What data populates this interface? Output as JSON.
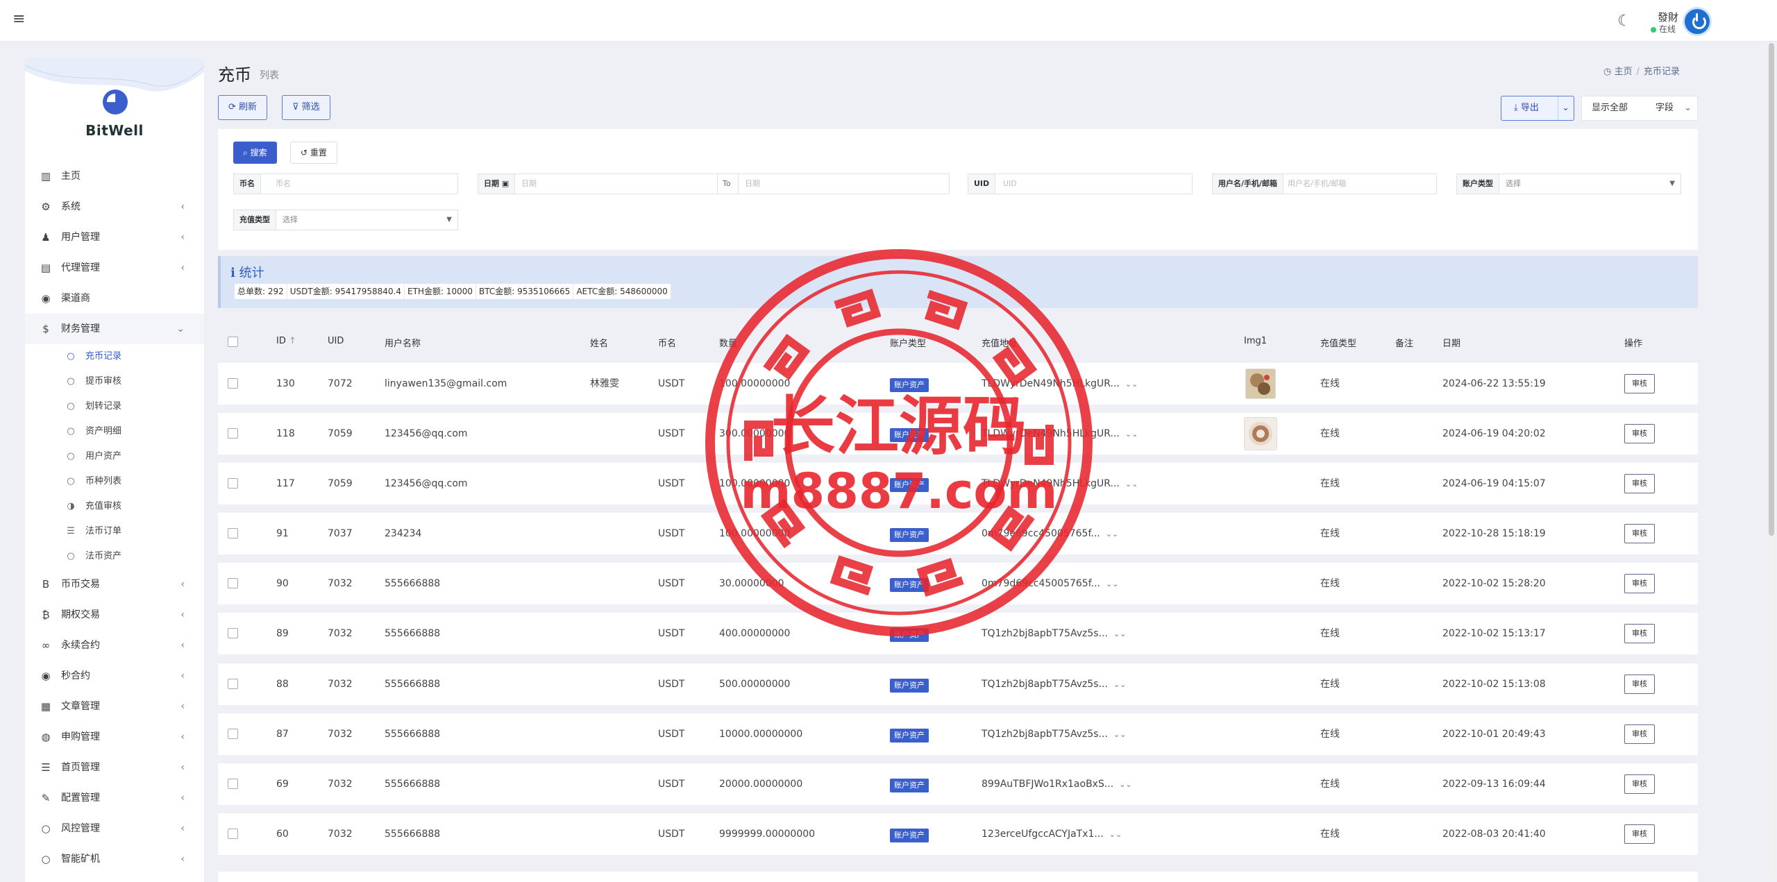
{
  "app": {
    "name": "BitWell"
  },
  "user": {
    "name": "發財",
    "status": "在线"
  },
  "page": {
    "title": "充币",
    "subtitle": "列表"
  },
  "breadcrumb": {
    "home": "主页",
    "current": "充币记录"
  },
  "toolbar": {
    "refresh": "刷新",
    "filter": "筛选",
    "export": "导出",
    "show_all": "显示全部",
    "fields": "字段"
  },
  "search": {
    "search_btn": "搜索",
    "reset_btn": "重置",
    "coin_label": "币名",
    "coin_ph": "币名",
    "date_label": "日期",
    "date_from_ph": "日期",
    "date_to": "To",
    "date_to_ph": "日期",
    "uid_label": "UID",
    "uid_ph": "UID",
    "user_label": "用户名/手机/邮箱",
    "user_ph": "用户名/手机/邮箱",
    "acct_label": "账户类型",
    "acct_ph": "选择",
    "recharge_label": "充值类型",
    "recharge_ph": "选择"
  },
  "stats": {
    "title": "统计",
    "items": [
      "总单数:  292",
      "USDT金额:  95417958840.4",
      "ETH金额:  10000",
      "BTC金额:  9535106665",
      "AETC金额:  548600000"
    ]
  },
  "sidebar": {
    "items": [
      {
        "label": "主页",
        "icon": "bar-chart-icon",
        "glyph": "▥"
      },
      {
        "label": "系统",
        "icon": "gear-icon",
        "glyph": "⚙",
        "chev": "‹"
      },
      {
        "label": "用户管理",
        "icon": "user-icon",
        "glyph": "♟",
        "chev": "‹"
      },
      {
        "label": "代理管理",
        "icon": "id-card-icon",
        "glyph": "▤",
        "chev": "‹"
      },
      {
        "label": "渠道商",
        "icon": "user-circle-icon",
        "glyph": "◉"
      },
      {
        "label": "财务管理",
        "icon": "dollar-icon",
        "glyph": "$",
        "chev": "⌄",
        "open": true
      }
    ],
    "finance_sub": [
      {
        "label": "充币记录",
        "icon": "circle-icon",
        "glyph": "○",
        "active": true
      },
      {
        "label": "提币审核",
        "icon": "circle-icon",
        "glyph": "○"
      },
      {
        "label": "划转记录",
        "icon": "circle-icon",
        "glyph": "○"
      },
      {
        "label": "资产明细",
        "icon": "circle-icon",
        "glyph": "○"
      },
      {
        "label": "用户资产",
        "icon": "circle-icon",
        "glyph": "○"
      },
      {
        "label": "币种列表",
        "icon": "circle-icon",
        "glyph": "○"
      },
      {
        "label": "充值审核",
        "icon": "half-circle-icon",
        "glyph": "◑"
      },
      {
        "label": "法币订单",
        "icon": "list-icon",
        "glyph": "☰"
      },
      {
        "label": "法币资产",
        "icon": "circle-icon",
        "glyph": "○"
      }
    ],
    "items2": [
      {
        "label": "币币交易",
        "icon": "bitcoin-icon",
        "glyph": "B",
        "chev": "‹"
      },
      {
        "label": "期权交易",
        "icon": "bitcoin-icon",
        "glyph": "₿",
        "chev": "‹"
      },
      {
        "label": "永续合约",
        "icon": "link-icon",
        "glyph": "∞",
        "chev": "‹"
      },
      {
        "label": "秒合约",
        "icon": "dot-circle-icon",
        "glyph": "◉",
        "chev": "‹"
      },
      {
        "label": "文章管理",
        "icon": "newspaper-icon",
        "glyph": "▦",
        "chev": "‹"
      },
      {
        "label": "申购管理",
        "icon": "globe-icon",
        "glyph": "◍",
        "chev": "‹"
      },
      {
        "label": "首页管理",
        "icon": "list-icon",
        "glyph": "☰",
        "chev": "‹"
      },
      {
        "label": "配置管理",
        "icon": "wrench-icon",
        "glyph": "✎",
        "chev": "‹"
      },
      {
        "label": "风控管理",
        "icon": "circle-icon",
        "glyph": "○",
        "chev": "‹"
      },
      {
        "label": "智能矿机",
        "icon": "circle-icon",
        "glyph": "○",
        "chev": "‹"
      }
    ]
  },
  "table": {
    "headers": [
      "ID",
      "UID",
      "用户名称",
      "姓名",
      "币名",
      "数量",
      "账户类型",
      "充值地址",
      "Img1",
      "充值类型",
      "备注",
      "日期",
      "操作"
    ],
    "sort_glyph": "↑",
    "rows": [
      {
        "id": "130",
        "uid": "7072",
        "user": "linyawen135@gmail.com",
        "name": "林雅雯",
        "coin": "USDT",
        "amount": "100.00000000",
        "acct": "账户资产",
        "addr": "TLDWyrDeN49Nh5HLkgUR...",
        "img": "food",
        "rtype": "在线",
        "note": "",
        "date": "2024-06-22 13:55:19",
        "op": "审核"
      },
      {
        "id": "118",
        "uid": "7059",
        "user": "123456@qq.com",
        "name": "",
        "coin": "USDT",
        "amount": "300.00000000",
        "acct": "账户资产",
        "addr": "TLDWyrDeN49Nh5HLkgUR...",
        "img": "coffee",
        "rtype": "在线",
        "note": "",
        "date": "2024-06-19 04:20:02",
        "op": "审核"
      },
      {
        "id": "117",
        "uid": "7059",
        "user": "123456@qq.com",
        "name": "",
        "coin": "USDT",
        "amount": "100.00000000",
        "acct": "账户资产",
        "addr": "TLDWyrDeN49Nh5HLkgUR...",
        "img": "",
        "rtype": "在线",
        "note": "",
        "date": "2024-06-19 04:15:07",
        "op": "审核"
      },
      {
        "id": "91",
        "uid": "7037",
        "user": "234234",
        "name": "",
        "coin": "USDT",
        "amount": "100.00000000",
        "acct": "账户资产",
        "addr": "0m79e69cc45005765f...",
        "img": "",
        "rtype": "在线",
        "note": "",
        "date": "2022-10-28 15:18:19",
        "op": "审核"
      },
      {
        "id": "90",
        "uid": "7032",
        "user": "555666888",
        "name": "",
        "coin": "USDT",
        "amount": "30.00000000",
        "acct": "账户资产",
        "addr": "0m79d69cc45005765f...",
        "img": "",
        "rtype": "在线",
        "note": "",
        "date": "2022-10-02 15:28:20",
        "op": "审核"
      },
      {
        "id": "89",
        "uid": "7032",
        "user": "555666888",
        "name": "",
        "coin": "USDT",
        "amount": "400.00000000",
        "acct": "账户资产",
        "addr": "TQ1zh2bj8apbT75Avz5s...",
        "img": "",
        "rtype": "在线",
        "note": "",
        "date": "2022-10-02 15:13:17",
        "op": "审核"
      },
      {
        "id": "88",
        "uid": "7032",
        "user": "555666888",
        "name": "",
        "coin": "USDT",
        "amount": "500.00000000",
        "acct": "账户资产",
        "addr": "TQ1zh2bj8apbT75Avz5s...",
        "img": "",
        "rtype": "在线",
        "note": "",
        "date": "2022-10-02 15:13:08",
        "op": "审核"
      },
      {
        "id": "87",
        "uid": "7032",
        "user": "555666888",
        "name": "",
        "coin": "USDT",
        "amount": "10000.00000000",
        "acct": "账户资产",
        "addr": "TQ1zh2bj8apbT75Avz5s...",
        "img": "",
        "rtype": "在线",
        "note": "",
        "date": "2022-10-01 20:49:43",
        "op": "审核"
      },
      {
        "id": "69",
        "uid": "7032",
        "user": "555666888",
        "name": "",
        "coin": "USDT",
        "amount": "20000.00000000",
        "acct": "账户资产",
        "addr": "899AuTBFJWo1Rx1aoBxS...",
        "img": "",
        "rtype": "在线",
        "note": "",
        "date": "2022-09-13 16:09:44",
        "op": "审核"
      },
      {
        "id": "60",
        "uid": "7032",
        "user": "555666888",
        "name": "",
        "coin": "USDT",
        "amount": "9999999.00000000",
        "acct": "账户资产",
        "addr": "123erceUfgccACYJaTx1...",
        "img": "",
        "rtype": "在线",
        "note": "",
        "date": "2022-08-03 20:41:40",
        "op": "审核"
      }
    ]
  },
  "watermark": {
    "line1": "长江源码",
    "line2": "m8887.com"
  },
  "colors": {
    "accent": "#3a5fcd",
    "stamp": "#e8262f"
  }
}
